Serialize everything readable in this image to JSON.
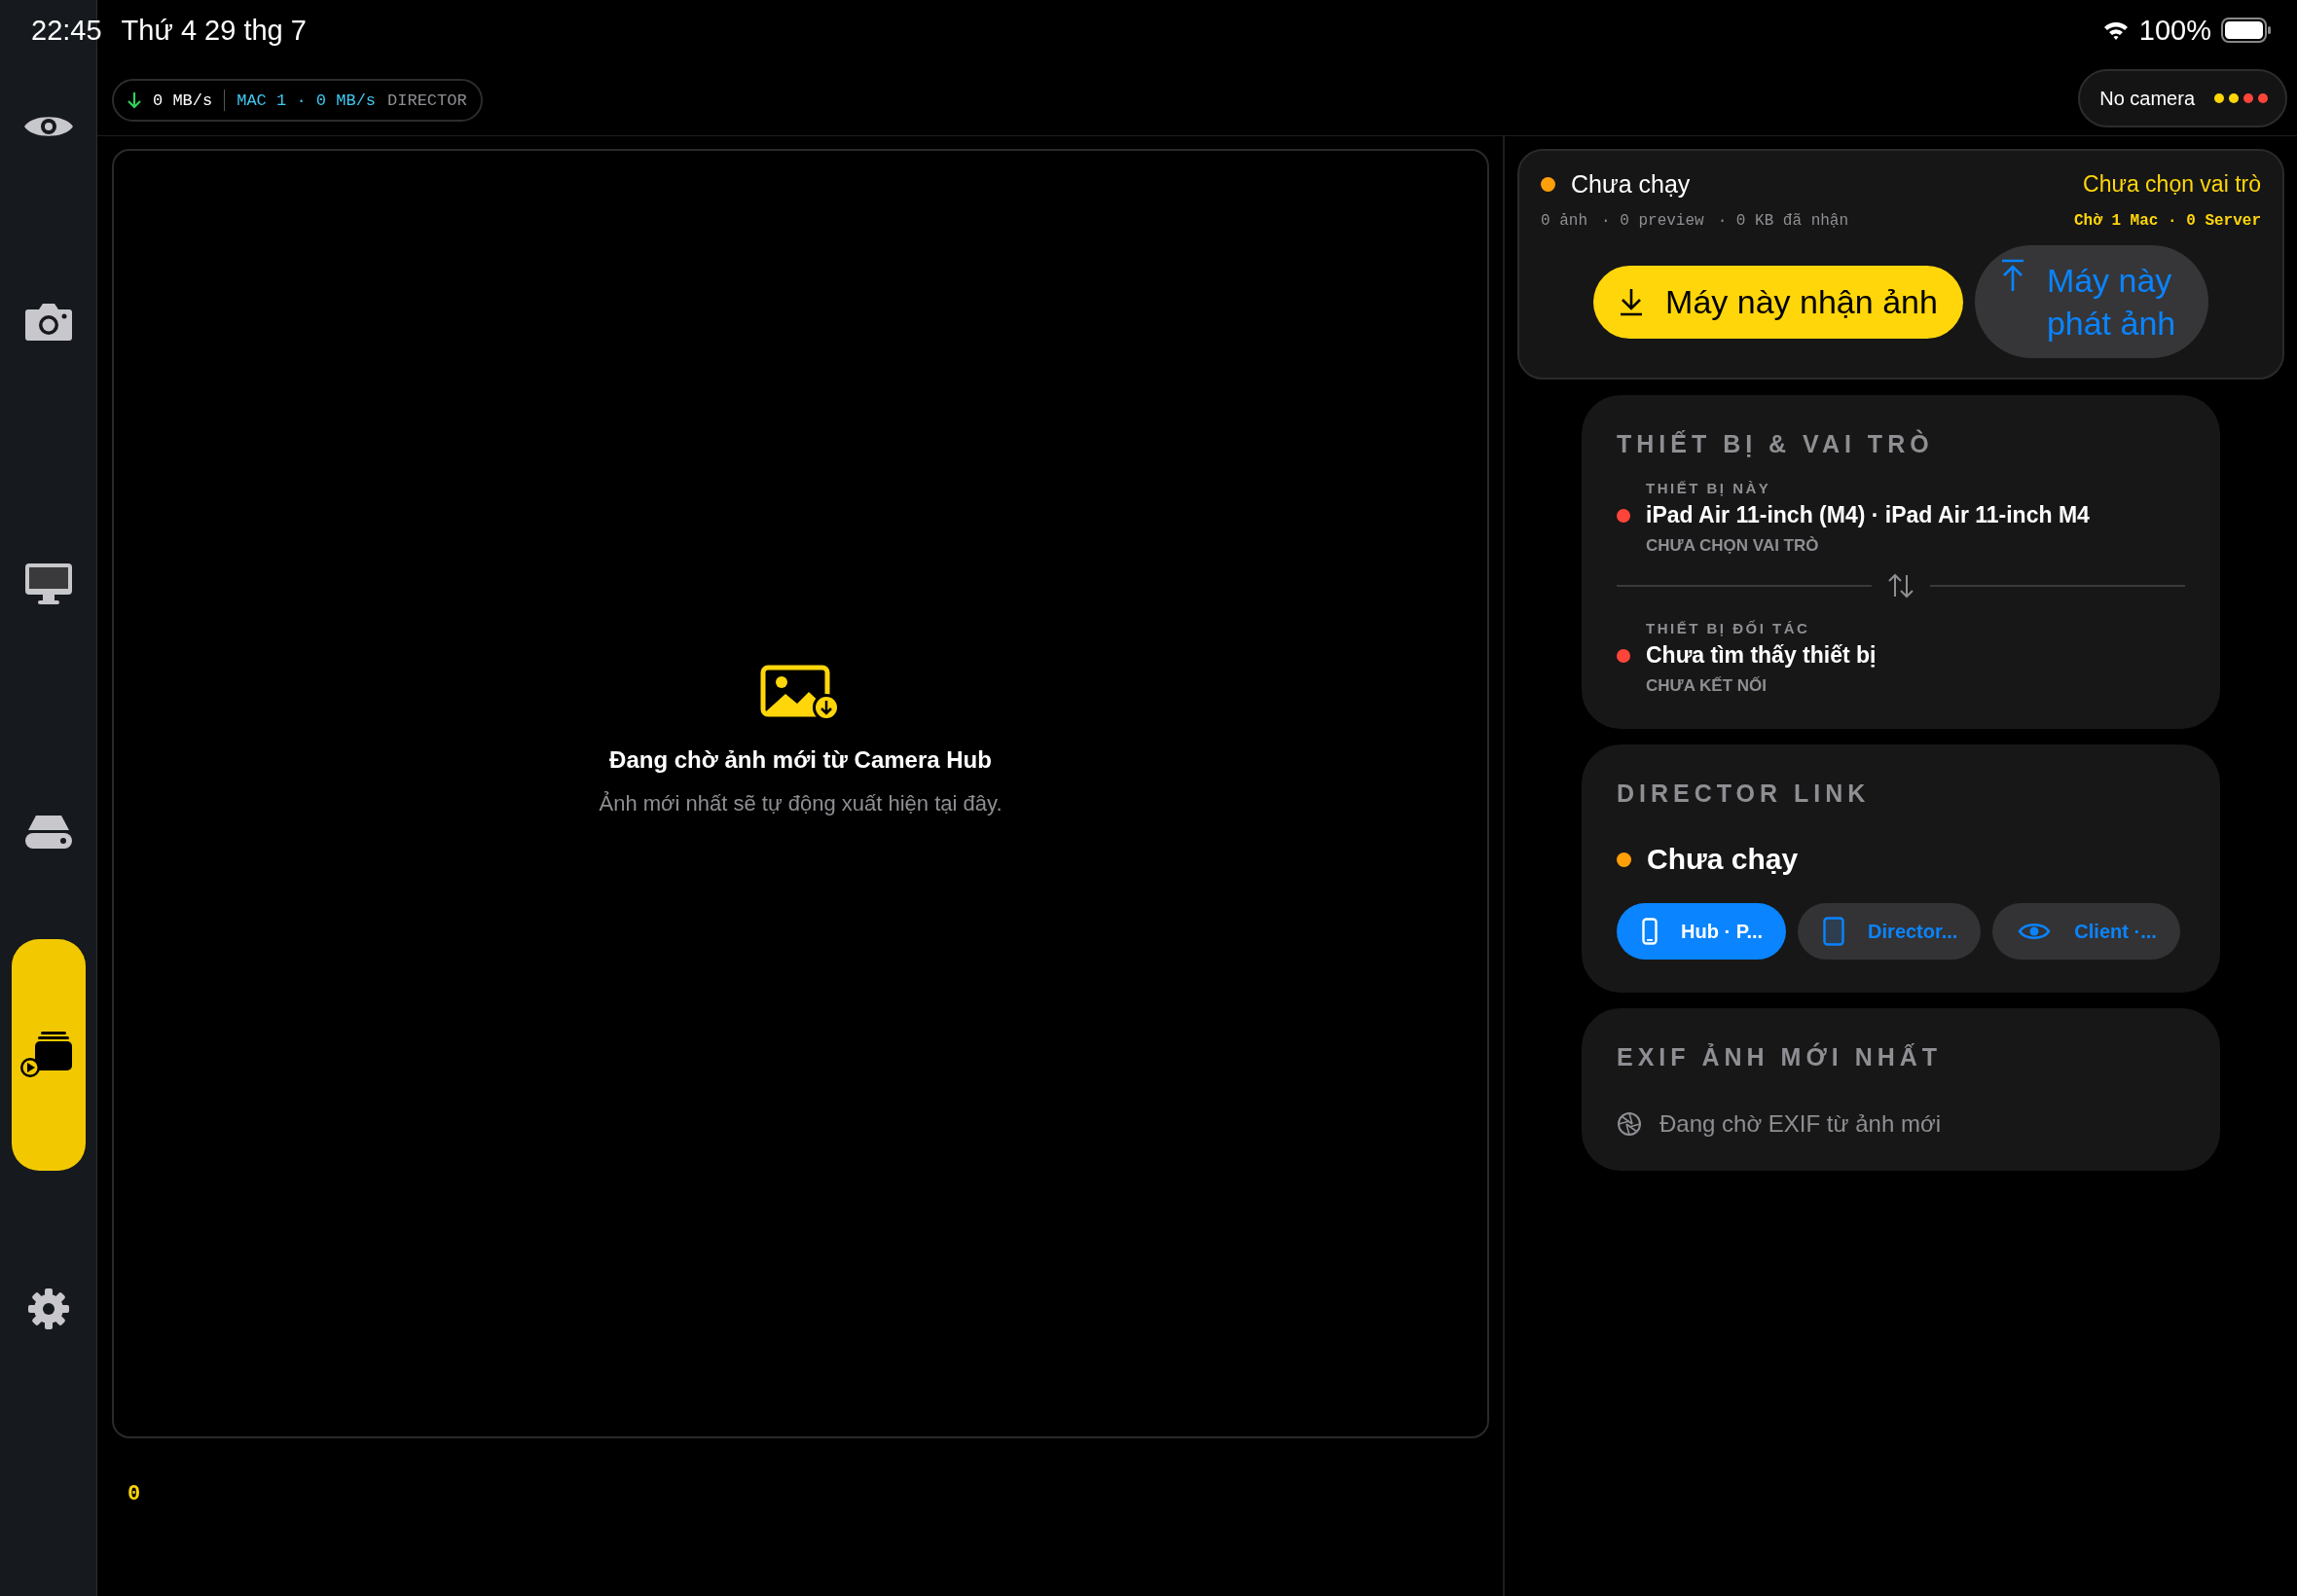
{
  "status_bar": {
    "time": "22:45",
    "date": "Thứ 4 29 thg 7",
    "battery": "100%"
  },
  "sidebar": {
    "items": [
      {
        "kind": "eye",
        "selected": false
      },
      {
        "kind": "camera",
        "selected": false
      },
      {
        "kind": "monitor",
        "selected": false
      },
      {
        "kind": "drive",
        "selected": false
      },
      {
        "kind": "stack",
        "selected": true
      },
      {
        "kind": "gear",
        "selected": false
      }
    ]
  },
  "transfer_chip": {
    "download_rate": "0 MB/s",
    "mac": "MAC 1 · 0 MB/s",
    "role": "DIRECTOR"
  },
  "camera_chip": {
    "label": "No camera",
    "dots": [
      {
        "color": "#ffd60a"
      },
      {
        "color": "#ffd60a"
      },
      {
        "color": "#ff453a"
      },
      {
        "color": "#ff453a"
      }
    ]
  },
  "preview": {
    "title": "Đang chờ ảnh mới từ Camera Hub",
    "subtitle": "Ảnh mới nhất sẽ tự động xuất hiện tại đây.",
    "counter": "0"
  },
  "status_card": {
    "status": "Chưa chạy",
    "role": "Chưa chọn vai trò",
    "stats": [
      "0 ảnh",
      "· 0 preview",
      "· 0 KB đã nhận"
    ],
    "waiting": "Chờ 1 Mac · 0 Server",
    "role_buttons": [
      {
        "label": "Máy này nhận ảnh",
        "kind": "receive"
      },
      {
        "label": "Máy này phát ảnh",
        "kind": "send"
      }
    ]
  },
  "devices": {
    "title": "THIẾT BỊ & VAI TRÒ",
    "entries": [
      {
        "label": "THIẾT BỊ NÀY",
        "name": "iPad Air 11-inch (M4) · iPad Air 11-inch M4",
        "status": "CHƯA CHỌN VAI TRÒ"
      },
      {
        "label": "THIẾT BỊ ĐỐI TÁC",
        "name": "Chưa tìm thấy thiết bị",
        "status": "CHƯA KẾT NỐI"
      }
    ]
  },
  "director_link": {
    "title": "DIRECTOR LINK",
    "status": "Chưa chạy",
    "modes": [
      {
        "label": "Hub · P...",
        "kind": "phone",
        "selected": true
      },
      {
        "label": "Director...",
        "kind": "tablet",
        "selected": false
      },
      {
        "label": "Client ·...",
        "kind": "eye",
        "selected": false
      }
    ]
  },
  "exif": {
    "title": "EXIF ẢNH MỚI NHẤT",
    "message": "Đang chờ EXIF từ ảnh mới"
  }
}
